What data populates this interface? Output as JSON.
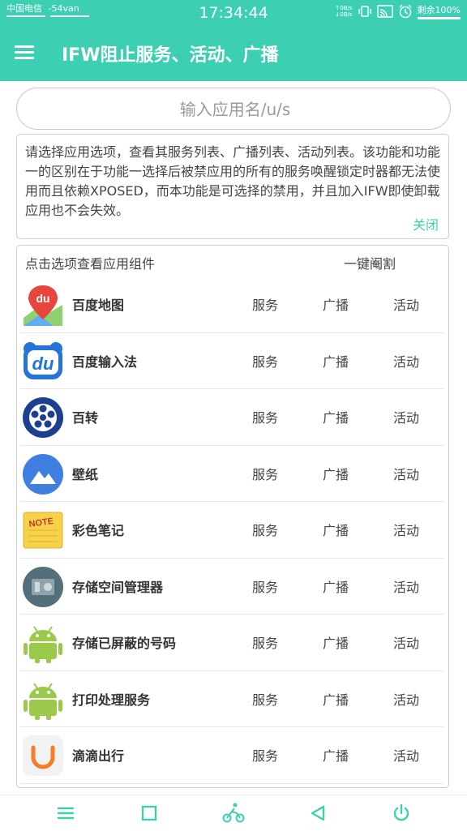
{
  "statusbar": {
    "carrier": "中国电信",
    "signal": "-54van",
    "time": "17:34:44",
    "rate_up": "0B/s",
    "rate_down": "0B/s",
    "battery": "剩余100%"
  },
  "appbar": {
    "title": "IFW阻止服务、活动、广播"
  },
  "search": {
    "placeholder": "输入应用名/u/s",
    "value": ""
  },
  "info": {
    "text": "请选择应用选项，查看其服务列表、广播列表、活动列表。该功能和功能一的区别在于功能一选择后被禁应用的所有的服务唤醒锁定时器都无法使用而且依赖XPOSED，而本功能是可选择的禁用，并且加入IFW即使卸载应用也不会失效。",
    "close_label": "关闭"
  },
  "list": {
    "header": "点击选项查看应用组件",
    "action_label": "一键阉割",
    "columns": {
      "service": "服务",
      "broadcast": "广播",
      "activity": "活动"
    },
    "apps": [
      {
        "name": "百度地图",
        "icon": "baidu-map-icon"
      },
      {
        "name": "百度输入法",
        "icon": "baidu-input-icon"
      },
      {
        "name": "百转",
        "icon": "baizhuan-icon"
      },
      {
        "name": "壁纸",
        "icon": "wallpaper-icon"
      },
      {
        "name": "彩色笔记",
        "icon": "color-note-icon"
      },
      {
        "name": "存储空间管理器",
        "icon": "storage-manager-icon"
      },
      {
        "name": "存储已屏蔽的号码",
        "icon": "android-icon"
      },
      {
        "name": "打印处理服务",
        "icon": "android-icon"
      },
      {
        "name": "滴滴出行",
        "icon": "didi-icon"
      }
    ]
  },
  "icon_texts": {
    "baidu": "du",
    "note": "NOTE"
  },
  "colors": {
    "accent": "#3ccfb1",
    "android_green": "#9bc94a",
    "didi_orange": "#f57d27"
  }
}
